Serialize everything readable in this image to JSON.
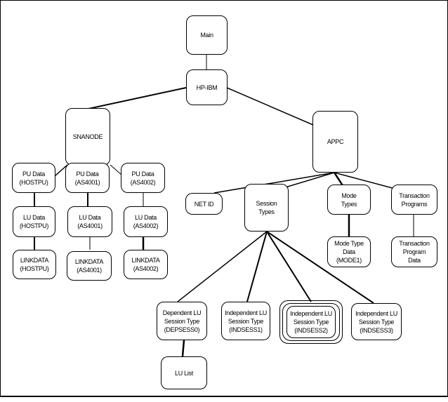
{
  "nodes": {
    "main": "Main",
    "hpibm": "HP-IBM",
    "snanode": "SNANODE",
    "appc": "APPC",
    "pu_hostpu": "PU Data\n(HOSTPU)",
    "pu_as4001": "PU Data\n(AS4001)",
    "pu_as4002": "PU Data\n(AS4002)",
    "lu_hostpu": "LU Data\n(HOSTPU)",
    "lu_as4001": "LU Data\n(AS4001)",
    "lu_as4002": "LU Data\n(AS4002)",
    "link_hostpu": "LINKDATA\n(HOSTPU)",
    "link_as4001": "LINKDATA\n(AS4001)",
    "link_as4002": "LINKDATA\n(AS4002)",
    "netid": "NET ID",
    "session_types": "Session\nTypes",
    "mode_types": "Mode\nTypes",
    "tp": "Transaction\nPrograms",
    "mode_type_data": "Mode Type\nData\n(MODE1)",
    "tp_data": "Transaction\nProgram\nData",
    "depsess0": "Dependent LU\nSession Type\n(DEPSESS0)",
    "indsess1": "Independent LU\nSession Type\n(INDSESS1)",
    "indsess2": "Independent LU\nSession Type\n(INDSESS2)",
    "indsess3": "Independent LU\nSession Type\n(INDSESS3)",
    "lu_list": "LU List"
  },
  "selected_node": "indsess2"
}
